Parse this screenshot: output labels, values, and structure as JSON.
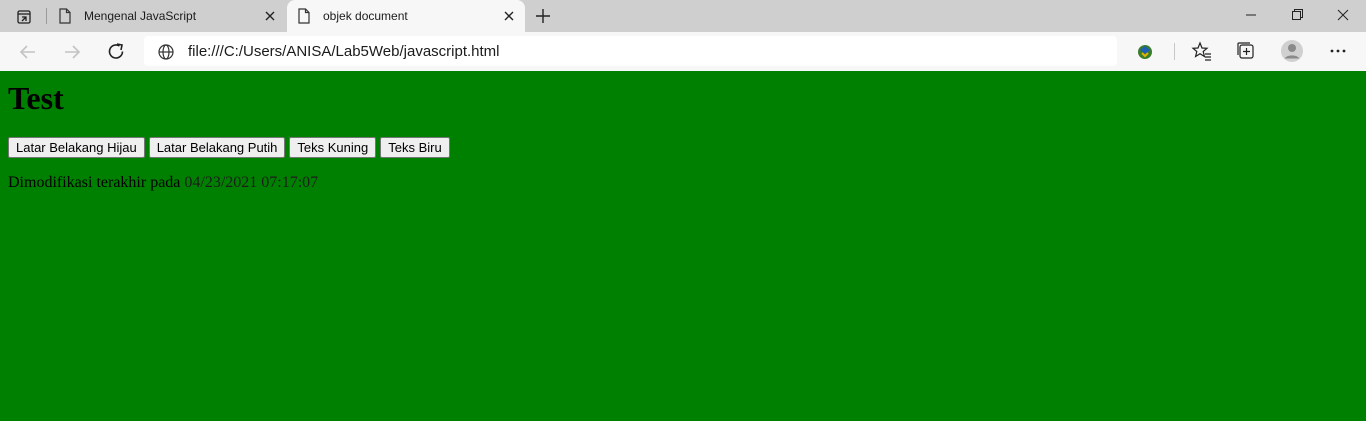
{
  "browser": {
    "tabs": [
      {
        "title": "Mengenal JavaScript",
        "active": false
      },
      {
        "title": "objek document",
        "active": true
      }
    ],
    "address": "file:///C:/Users/ANISA/Lab5Web/javascript.html"
  },
  "page": {
    "heading": "Test",
    "buttons": [
      {
        "label": "Latar Belakang Hijau"
      },
      {
        "label": "Latar Belakang Putih"
      },
      {
        "label": "Teks Kuning"
      },
      {
        "label": "Teks Biru"
      }
    ],
    "modified_label": "Dimodifikasi terakhir pada",
    "modified_date": "04/23/2021 07:17:07",
    "background_color": "#008000"
  },
  "icons": {
    "tab_actions": "tab-actions-icon",
    "page": "document-icon",
    "close": "close-icon",
    "new_tab": "plus-icon",
    "back": "back-arrow-icon",
    "forward": "forward-arrow-icon",
    "reload": "reload-icon",
    "globe": "globe-icon",
    "extension": "extension-icon",
    "favorites": "favorites-icon",
    "collections": "collections-icon",
    "profile": "profile-icon",
    "more": "more-icon"
  }
}
